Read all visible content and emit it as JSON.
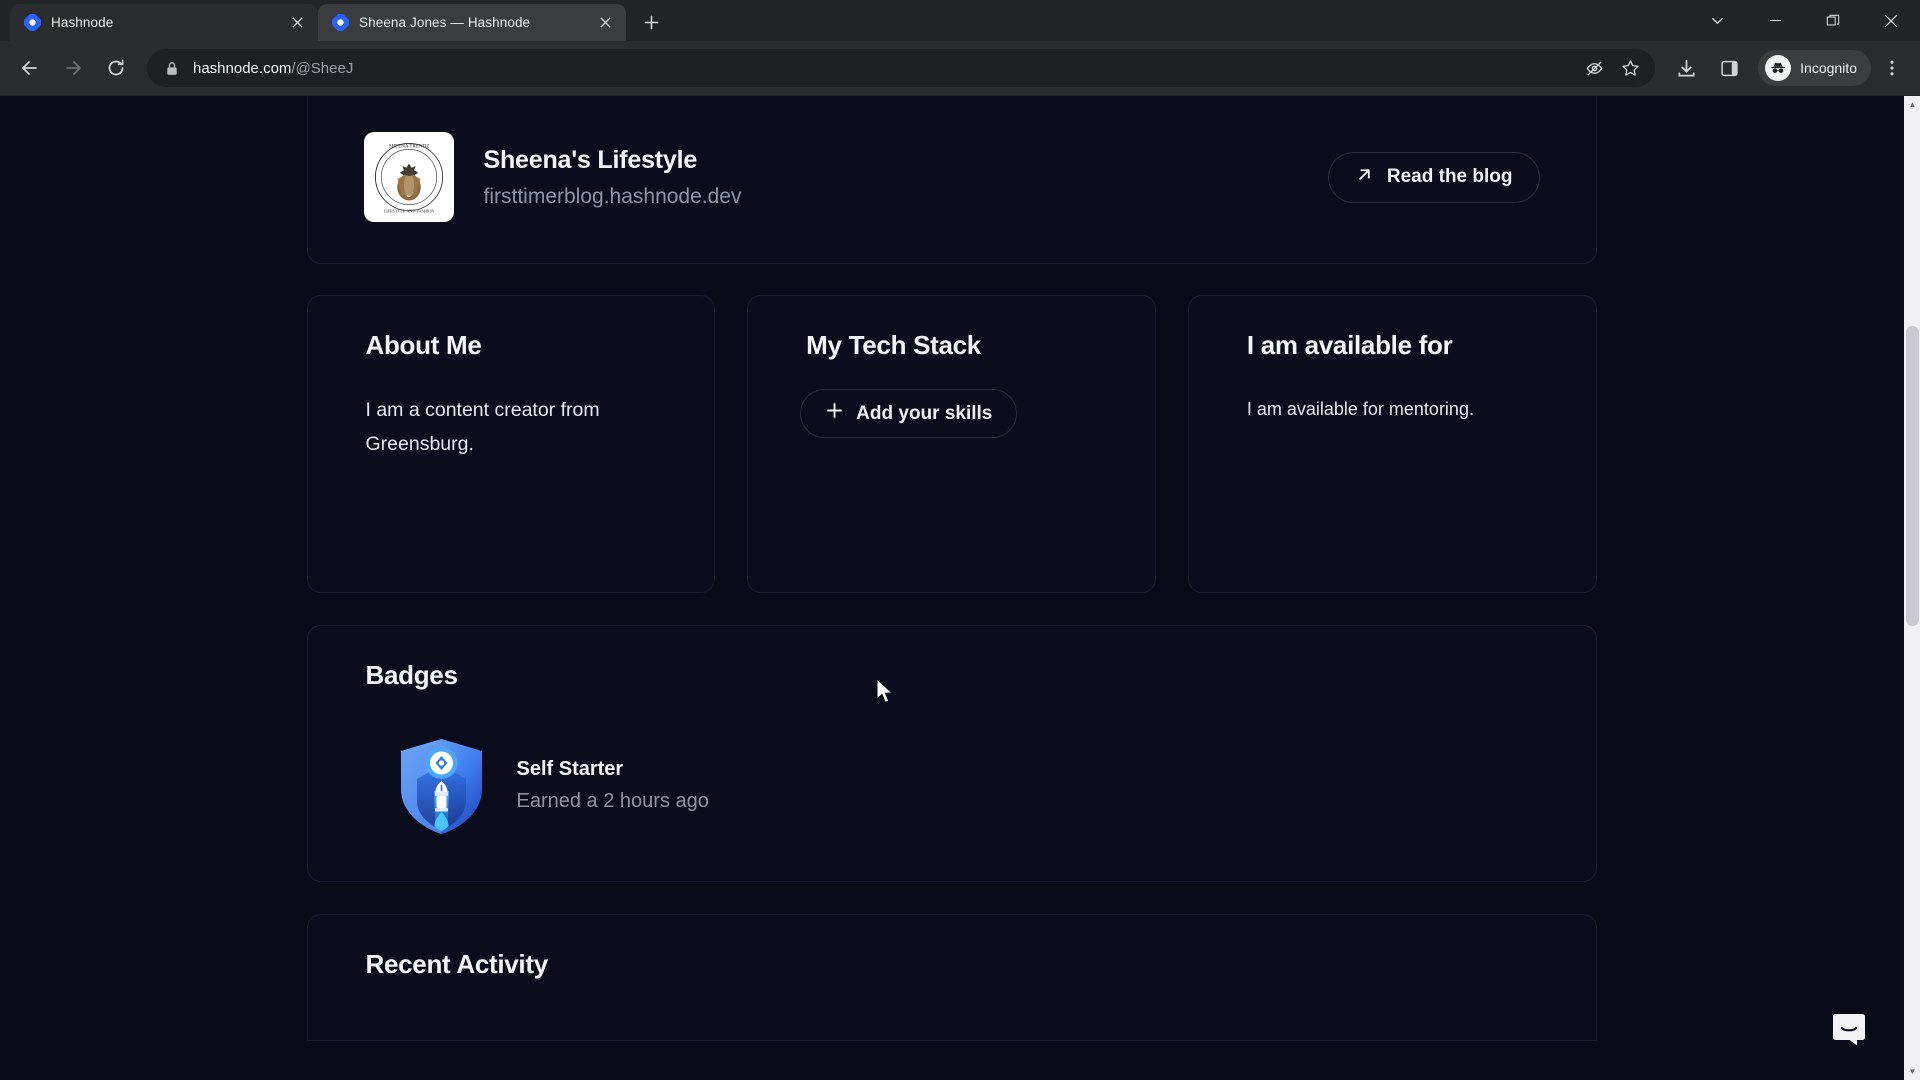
{
  "browser": {
    "tabs": [
      {
        "title": "Hashnode",
        "icon": "hashnode-favicon",
        "active": false
      },
      {
        "title": "Sheena Jones — Hashnode",
        "icon": "hashnode-favicon",
        "active": true
      }
    ],
    "new_tab_label": "+",
    "window_controls": [
      "tab-search-chevron",
      "minimize",
      "maximize",
      "close"
    ],
    "nav": {
      "back": "back-arrow",
      "forward": "forward-arrow",
      "reload": "reload-arrow"
    },
    "address": {
      "lock_icon": "lock-icon",
      "domain": "hashnode.com",
      "path": "/@SheeJ",
      "full_url": "hashnode.com/@SheeJ"
    },
    "omni_actions": [
      "hide-incognito-eye-icon",
      "bookmark-star-icon"
    ],
    "toolbar_actions": [
      "download-icon",
      "side-panel-icon"
    ],
    "profile": {
      "label": "Incognito",
      "icon": "incognito-hat-icon"
    },
    "menu_icon": "three-dot-menu-icon"
  },
  "page": {
    "blog": {
      "name": "Sheena's Lifestyle",
      "url": "firsttimerblog.hashnode.dev",
      "avatar_alt": "sheena-lifestyle-logo",
      "read_button": {
        "label": "Read the blog",
        "icon": "external-link-arrow-icon"
      }
    },
    "cards": [
      {
        "title": "About Me",
        "text": "I am a content creator from Greensburg."
      },
      {
        "title": "My Tech Stack",
        "button": {
          "label": "Add your skills",
          "icon": "plus-icon"
        }
      },
      {
        "title": "I am available for",
        "text": "I am available for mentoring."
      }
    ],
    "badges": {
      "title": "Badges",
      "items": [
        {
          "name": "Self Starter",
          "earned": "Earned a 2 hours ago",
          "icon": "self-starter-shield-badge"
        }
      ]
    },
    "recent_activity": {
      "title": "Recent Activity"
    },
    "chat_widget": {
      "icon": "intercom-chat-icon",
      "color": "#f3f3f6"
    }
  },
  "colors": {
    "page_bg": "#0a0b19",
    "card_bg": "#0c0d1c",
    "card_border": "#1c1d33",
    "accent_blue": "#2962ff",
    "text_primary": "#f3f4f8",
    "text_muted": "#8e93a8"
  }
}
